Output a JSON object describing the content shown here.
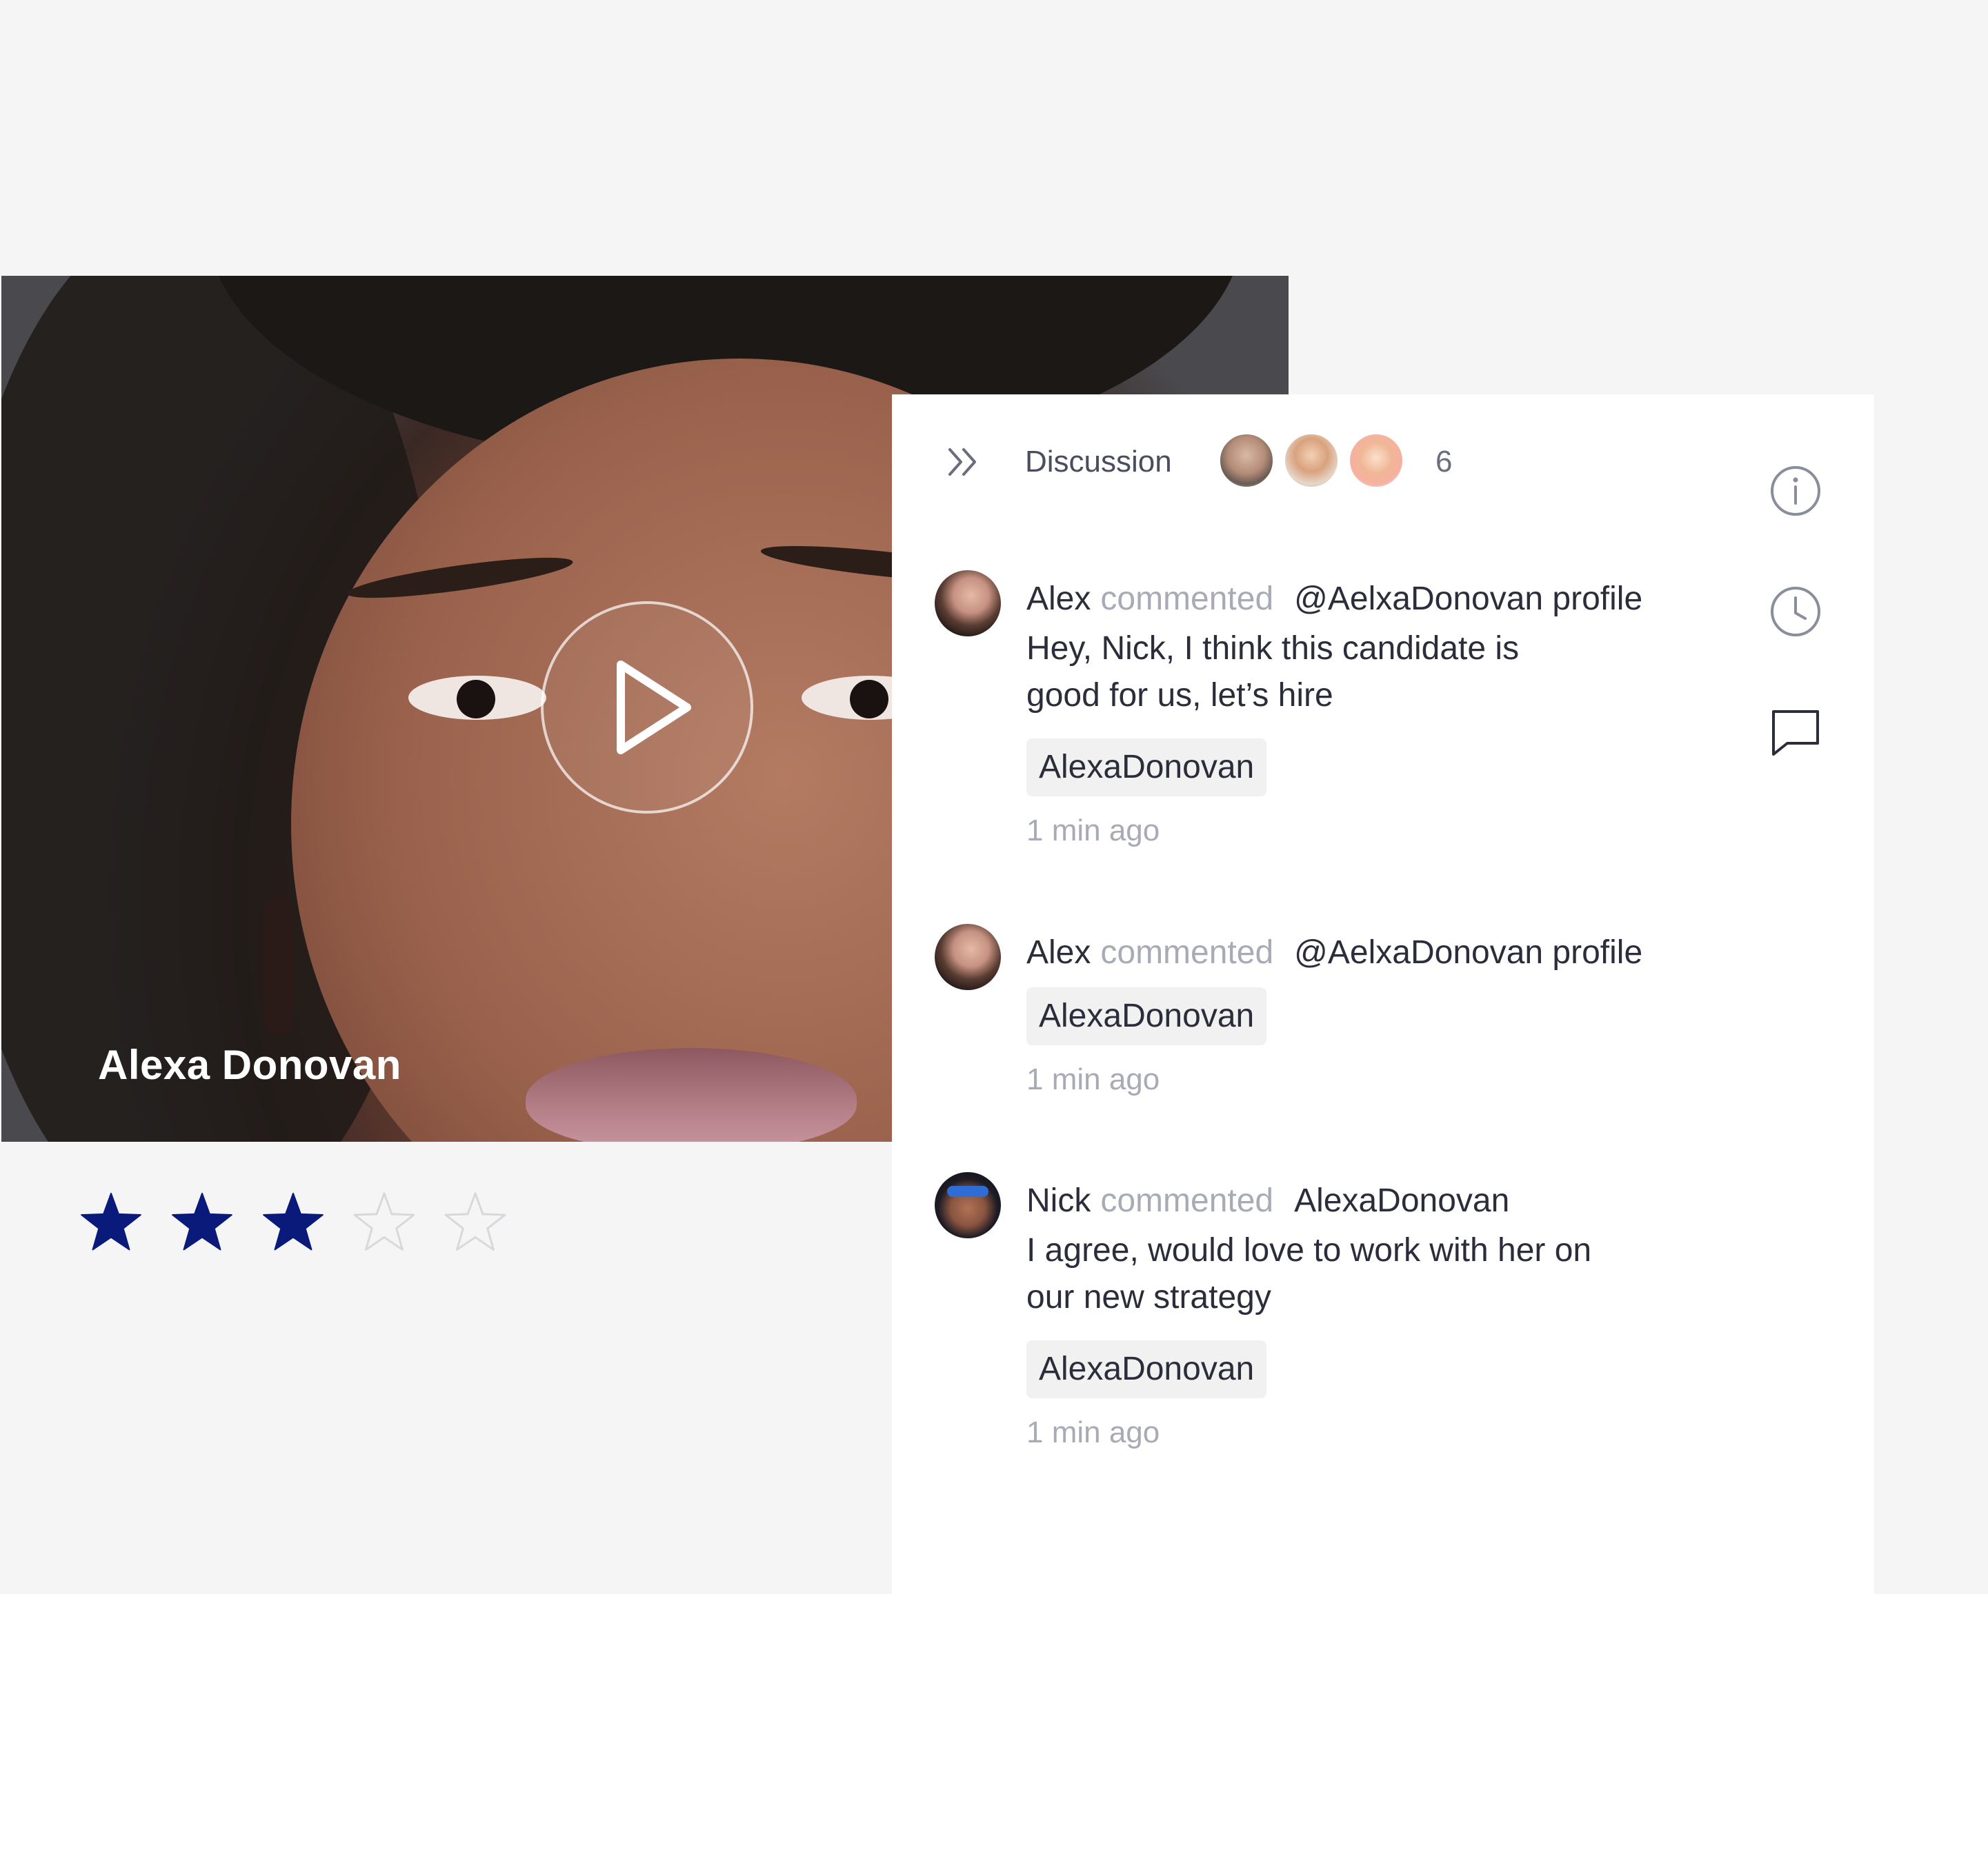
{
  "video": {
    "candidate_name": "Alexa Donovan",
    "play_icon": "play-icon"
  },
  "rating": {
    "value": 3,
    "max": 5,
    "filled_color": "#0a1a7a",
    "empty_color": "#d8d8dc"
  },
  "discussion": {
    "title": "Discussion",
    "participant_count": "6",
    "collapse_icon": "double-chevron-right-icon",
    "tools": [
      "info-icon",
      "clock-icon",
      "comment-icon"
    ]
  },
  "comments": [
    {
      "author": "Alex",
      "verb": "commented",
      "target": "@AelxaDonovan profile",
      "body_lines": [
        "Hey, Nick, I think this candidate is",
        "good for us, let’s hire"
      ],
      "tag": "AlexaDonovan",
      "time": "1 min ago"
    },
    {
      "author": "Alex",
      "verb": "commented",
      "target": "@AelxaDonovan profile",
      "body_lines": [],
      "tag": "AlexaDonovan",
      "time": "1 min ago"
    },
    {
      "author": "Nick",
      "verb": "commented",
      "target": "AlexaDonovan",
      "body_lines": [
        "I agree, would love to work with her on",
        "our new strategy"
      ],
      "tag": "AlexaDonovan",
      "time": "1 min ago"
    }
  ]
}
